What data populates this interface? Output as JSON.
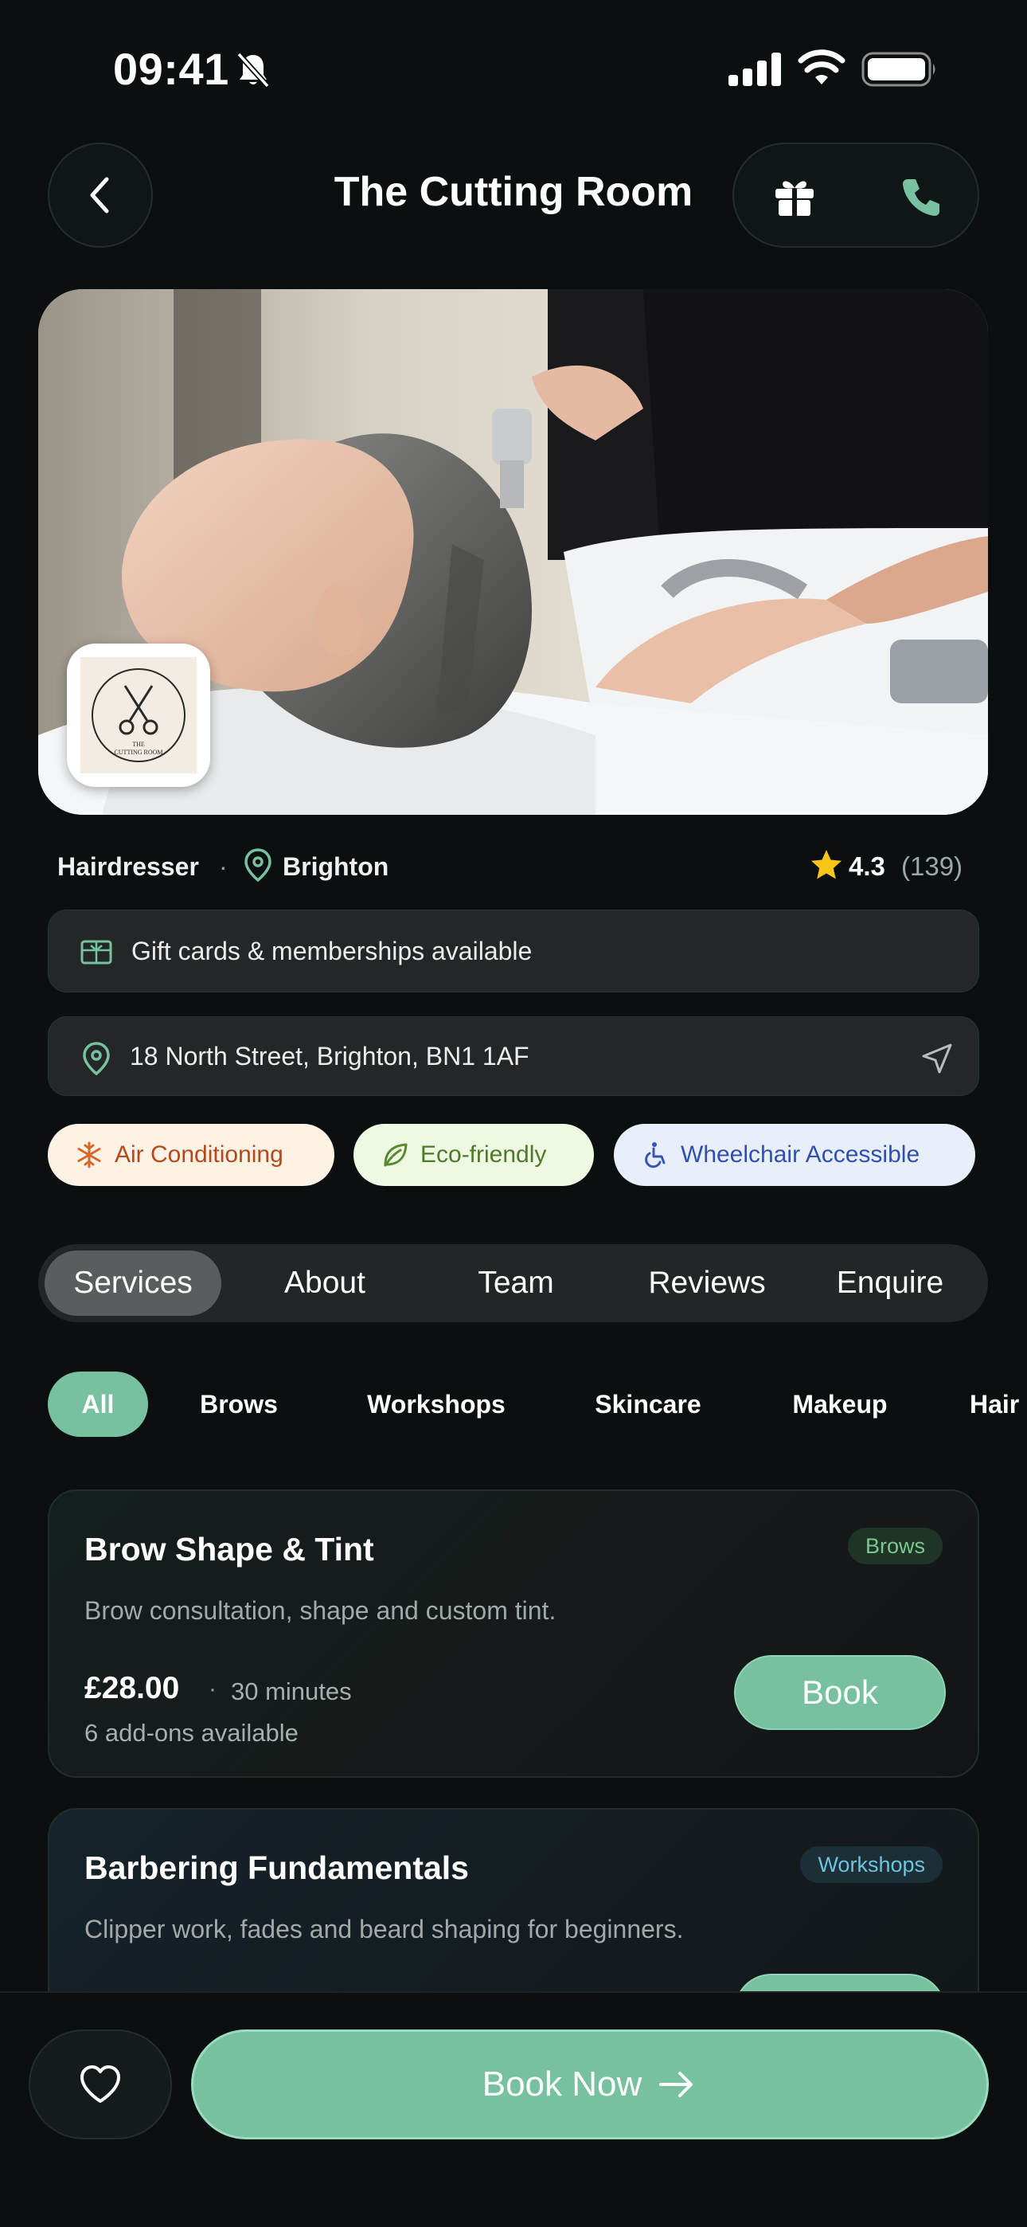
{
  "status_bar": {
    "time": "09:41"
  },
  "header": {
    "title": "The Cutting Room"
  },
  "hero": {
    "logo_text": "THE CUTTING ROOM"
  },
  "meta": {
    "category": "Hairdresser",
    "separator": "·",
    "location": "Brighton",
    "rating": "4.3",
    "rating_count": "(139)"
  },
  "info": {
    "gift_cards": "Gift cards & memberships available",
    "address": "18 North Street, Brighton, BN1 1AF"
  },
  "features": [
    {
      "label": "Air Conditioning",
      "icon": "snowflake-icon"
    },
    {
      "label": "Eco-friendly",
      "icon": "leaf-icon"
    },
    {
      "label": "Wheelchair Accessible",
      "icon": "wheelchair-icon"
    }
  ],
  "tabs": [
    {
      "label": "Services",
      "active": true
    },
    {
      "label": "About"
    },
    {
      "label": "Team"
    },
    {
      "label": "Reviews"
    },
    {
      "label": "Enquire"
    }
  ],
  "filters": [
    {
      "label": "All",
      "active": true
    },
    {
      "label": "Brows"
    },
    {
      "label": "Workshops"
    },
    {
      "label": "Skincare"
    },
    {
      "label": "Makeup"
    },
    {
      "label": "Hair"
    }
  ],
  "services": [
    {
      "title": "Brow Shape & Tint",
      "tag": "Brows",
      "description": "Brow consultation, shape and custom tint.",
      "price": "£28.00",
      "separator": "·",
      "duration": "30 minutes",
      "addons": "6 add-ons available",
      "book_label": "Book"
    },
    {
      "title": "Barbering Fundamentals",
      "tag": "Workshops",
      "description": "Clipper work, fades and beard shaping for beginners."
    }
  ],
  "bottom_bar": {
    "book_now_label": "Book Now"
  },
  "colors": {
    "accent": "#77c0a0",
    "background": "#0b0f0f",
    "card": "#232727"
  }
}
